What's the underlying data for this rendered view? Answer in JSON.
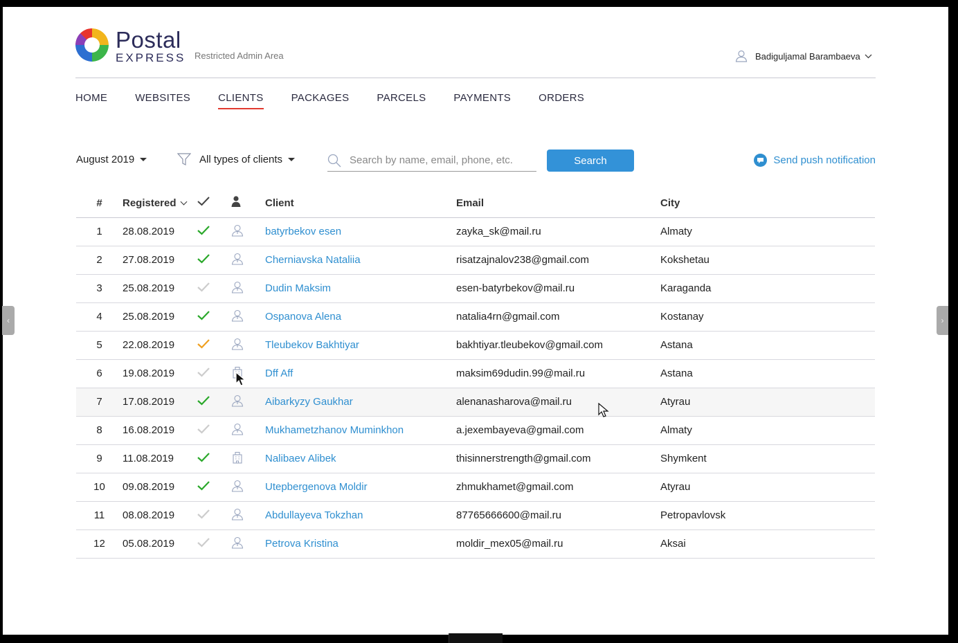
{
  "header": {
    "logo_top": "Postal",
    "logo_bottom": "EXPRESS",
    "subtitle": "Restricted Admin Area",
    "user_name": "Badiguljamal Barambaeva"
  },
  "nav": {
    "items": [
      "HOME",
      "WEBSITES",
      "CLIENTS",
      "PACKAGES",
      "PARCELS",
      "PAYMENTS",
      "ORDERS"
    ],
    "active": "CLIENTS"
  },
  "toolbar": {
    "month": "August 2019",
    "client_filter": "All types of clients",
    "search_placeholder": "Search by name, email, phone, etc.",
    "search_value": "",
    "search_button": "Search",
    "push_label": "Send push notification"
  },
  "colors": {
    "accent_blue": "#2f8fd0",
    "button_blue": "#3392d8",
    "active_underline": "#e23a2f",
    "check_green": "#2aa82a",
    "check_orange": "#f0a020",
    "check_grey": "#cccccc"
  },
  "table": {
    "headers": {
      "num": "#",
      "registered": "Registered",
      "client": "Client",
      "email": "Email",
      "city": "City"
    },
    "rows": [
      {
        "num": "1",
        "registered": "28.08.2019",
        "status": "green",
        "type": "person",
        "client": "batyrbekov esen",
        "email": "zayka_sk@mail.ru",
        "city": "Almaty"
      },
      {
        "num": "2",
        "registered": "27.08.2019",
        "status": "green",
        "type": "person",
        "client": "Cherniavska Nataliia",
        "email": "risatzajnalov238@gmail.com",
        "city": "Kokshetau"
      },
      {
        "num": "3",
        "registered": "25.08.2019",
        "status": "grey",
        "type": "person",
        "client": "Dudin Maksim",
        "email": "esen-batyrbekov@mail.ru",
        "city": "Karaganda"
      },
      {
        "num": "4",
        "registered": "25.08.2019",
        "status": "green",
        "type": "person",
        "client": "Ospanova Alena",
        "email": "natalia4rn@gmail.com",
        "city": "Kostanay"
      },
      {
        "num": "5",
        "registered": "22.08.2019",
        "status": "orange",
        "type": "person",
        "client": "Tleubekov Bakhtiyar",
        "email": "bakhtiyar.tleubekov@gmail.com",
        "city": "Astana"
      },
      {
        "num": "6",
        "registered": "19.08.2019",
        "status": "grey",
        "type": "building",
        "client": "Dff Aff",
        "email": "maksim69dudin.99@mail.ru",
        "city": "Astana"
      },
      {
        "num": "7",
        "registered": "17.08.2019",
        "status": "green",
        "type": "person",
        "client": "Aibarkyzy Gaukhar",
        "email": "alenanasharova@mail.ru",
        "city": "Atyrau"
      },
      {
        "num": "8",
        "registered": "16.08.2019",
        "status": "grey",
        "type": "person",
        "client": "Mukhametzhanov Muminkhon",
        "email": "a.jexembayeva@gmail.com",
        "city": "Almaty"
      },
      {
        "num": "9",
        "registered": "11.08.2019",
        "status": "green",
        "type": "building",
        "client": "Nalibaev Alibek",
        "email": "thisinnerstrength@gmail.com",
        "city": "Shymkent"
      },
      {
        "num": "10",
        "registered": "09.08.2019",
        "status": "green",
        "type": "person",
        "client": "Utepbergenova Moldir",
        "email": "zhmukhamet@gmail.com",
        "city": "Atyrau"
      },
      {
        "num": "11",
        "registered": "08.08.2019",
        "status": "grey",
        "type": "person",
        "client": "Abdullayeva Tokzhan",
        "email": "87765666600@mail.ru",
        "city": "Petropavlovsk"
      },
      {
        "num": "12",
        "registered": "05.08.2019",
        "status": "grey",
        "type": "person",
        "client": "Petrova Kristina",
        "email": "moldir_mex05@mail.ru",
        "city": "Aksai"
      }
    ]
  }
}
